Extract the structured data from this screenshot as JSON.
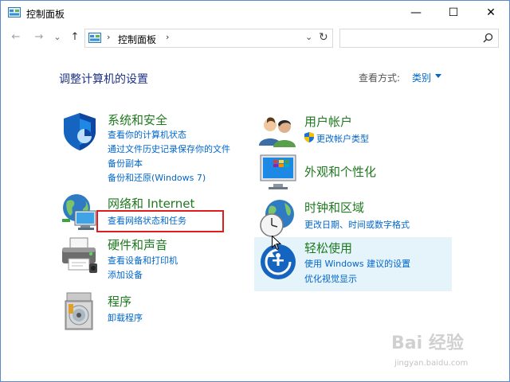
{
  "window": {
    "title": "控制面板",
    "minimize": "—",
    "maximize": "☐",
    "close": "✕"
  },
  "nav": {
    "back": "←",
    "forward": "→",
    "history": "⌄",
    "up": "↑",
    "address_sep": "›",
    "address_text": "控制面板",
    "dropdown": "⌄",
    "refresh": "↻",
    "search_placeholder": ""
  },
  "main": {
    "page_title": "调整计算机的设置",
    "view_by_label": "查看方式:",
    "view_by_value": "类别"
  },
  "categories": [
    {
      "title": "系统和安全",
      "icon": "shield-icon",
      "links": [
        "查看你的计算机状态",
        "通过文件历史记录保存你的文件",
        "备份副本",
        "备份和还原(Windows 7)"
      ]
    },
    {
      "title": "网络和 Internet",
      "icon": "globe-network-icon",
      "links": [
        "查看网络状态和任务"
      ]
    },
    {
      "title": "硬件和声音",
      "icon": "printer-icon",
      "links": [
        "查看设备和打印机",
        "添加设备"
      ]
    },
    {
      "title": "程序",
      "icon": "programs-disc-icon",
      "links": [
        "卸载程序"
      ]
    },
    {
      "title": "用户帐户",
      "icon": "users-icon",
      "links": [
        "更改帐户类型"
      ]
    },
    {
      "title": "外观和个性化",
      "icon": "monitor-icon",
      "links": []
    },
    {
      "title": "时钟和区域",
      "icon": "clock-globe-icon",
      "links": [
        "更改日期、时间或数字格式"
      ]
    },
    {
      "title": "轻松使用",
      "icon": "ease-of-access-icon",
      "links": [
        "使用 Windows 建议的设置",
        "优化视觉显示"
      ]
    }
  ],
  "watermark": {
    "brand": "Bai 经验",
    "url": "jingyan.baidu.com"
  },
  "colors": {
    "category_title": "#1e7a1e",
    "link": "#0066cc",
    "heading": "#1e3287",
    "highlight": "#e01d1d",
    "hover": "#e5f3fb"
  }
}
